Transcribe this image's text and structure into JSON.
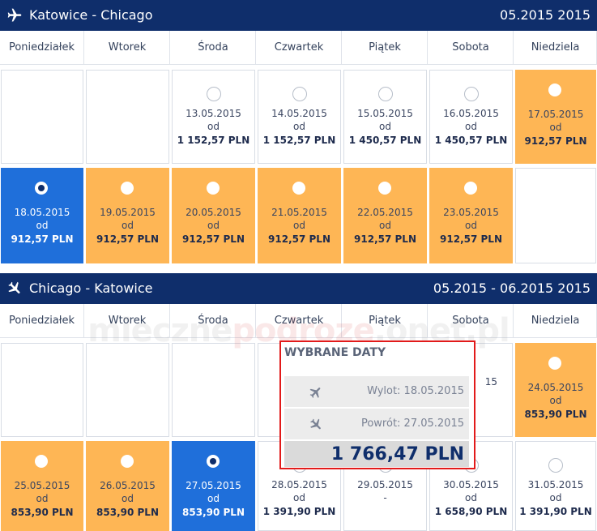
{
  "outbound": {
    "route": "Katowice - Chicago",
    "period": "05.2015 2015",
    "days": [
      "Poniedziałek",
      "Wtorek",
      "Środa",
      "Czwartek",
      "Piątek",
      "Sobota",
      "Niedziela"
    ],
    "week1": [
      {
        "type": "empty"
      },
      {
        "type": "empty"
      },
      {
        "type": "avail",
        "date": "13.05.2015",
        "od": "od",
        "price": "1 152,57 PLN"
      },
      {
        "type": "avail",
        "date": "14.05.2015",
        "od": "od",
        "price": "1 152,57 PLN"
      },
      {
        "type": "avail",
        "date": "15.05.2015",
        "od": "od",
        "price": "1 450,57 PLN"
      },
      {
        "type": "avail",
        "date": "16.05.2015",
        "od": "od",
        "price": "1 450,57 PLN"
      },
      {
        "type": "cheap",
        "date": "17.05.2015",
        "od": "od",
        "price": "912,57 PLN"
      }
    ],
    "week2": [
      {
        "type": "sel",
        "date": "18.05.2015",
        "od": "od",
        "price": "912,57 PLN"
      },
      {
        "type": "cheap",
        "date": "19.05.2015",
        "od": "od",
        "price": "912,57 PLN"
      },
      {
        "type": "cheap",
        "date": "20.05.2015",
        "od": "od",
        "price": "912,57 PLN"
      },
      {
        "type": "cheap",
        "date": "21.05.2015",
        "od": "od",
        "price": "912,57 PLN"
      },
      {
        "type": "cheap",
        "date": "22.05.2015",
        "od": "od",
        "price": "912,57 PLN"
      },
      {
        "type": "cheap",
        "date": "23.05.2015",
        "od": "od",
        "price": "912,57 PLN"
      },
      {
        "type": "empty"
      }
    ]
  },
  "inbound": {
    "route": "Chicago - Katowice",
    "period": "05.2015 - 06.2015 2015",
    "days": [
      "Poniedziałek",
      "Wtorek",
      "Środa",
      "Czwartek",
      "Piątek",
      "Sobota",
      "Niedziela"
    ],
    "week1": [
      {
        "type": "empty"
      },
      {
        "type": "empty"
      },
      {
        "type": "empty"
      },
      {
        "type": "empty"
      },
      {
        "type": "empty"
      },
      {
        "type": "partial",
        "date": "15"
      },
      {
        "type": "cheap",
        "date": "24.05.2015",
        "od": "od",
        "price": "853,90 PLN"
      }
    ],
    "week2": [
      {
        "type": "cheap",
        "date": "25.05.2015",
        "od": "od",
        "price": "853,90 PLN"
      },
      {
        "type": "cheap",
        "date": "26.05.2015",
        "od": "od",
        "price": "853,90 PLN"
      },
      {
        "type": "sel",
        "date": "27.05.2015",
        "od": "od",
        "price": "853,90 PLN"
      },
      {
        "type": "avail",
        "date": "28.05.2015",
        "od": "od",
        "price": "1 391,90 PLN"
      },
      {
        "type": "avail",
        "date": "29.05.2015",
        "od": "-",
        "price": ""
      },
      {
        "type": "avail",
        "date": "30.05.2015",
        "od": "od",
        "price": "1 658,90 PLN"
      },
      {
        "type": "avail",
        "date": "31.05.2015",
        "od": "od",
        "price": "1 391,90 PLN"
      }
    ]
  },
  "popup": {
    "title": "WYBRANE DATY",
    "departure": "Wylot: 18.05.2015",
    "return": "Powrót: 27.05.2015",
    "total": "1 766,47 PLN"
  },
  "watermark": {
    "part1": "mieczne",
    "part2": "podroze",
    "part3": ".onet.pl"
  },
  "colors": {
    "header": "#0f2e6b",
    "cheap": "#feb655",
    "selected": "#1f6fda",
    "highlight_border": "#e21a1a"
  }
}
